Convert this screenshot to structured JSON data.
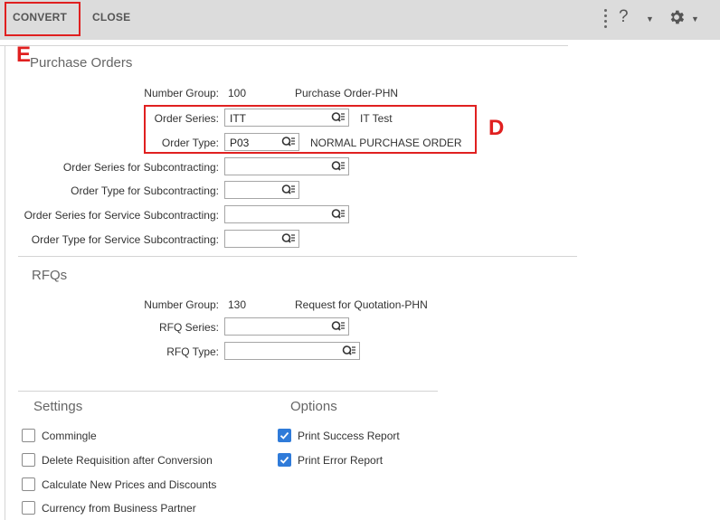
{
  "toolbar": {
    "convert_label": "CONVERT",
    "close_label": "CLOSE",
    "help_icon": "?",
    "caret": "▼"
  },
  "annotations": {
    "e": "E",
    "d": "D"
  },
  "purchase_orders": {
    "title": "Purchase Orders",
    "number_group_label": "Number Group:",
    "number_group_value": "100",
    "number_group_desc": "Purchase Order-PHN",
    "order_series_label": "Order Series:",
    "order_series_value": "ITT",
    "order_series_desc": "IT Test",
    "order_type_label": "Order Type:",
    "order_type_value": "P03",
    "order_type_desc": "NORMAL PURCHASE ORDER",
    "order_series_sub_label": "Order Series for Subcontracting:",
    "order_series_sub_value": "",
    "order_type_sub_label": "Order Type for Subcontracting:",
    "order_type_sub_value": "",
    "order_series_svc_label": "Order Series for Service Subcontracting:",
    "order_series_svc_value": "",
    "order_type_svc_label": "Order Type for Service Subcontracting:",
    "order_type_svc_value": ""
  },
  "rfqs": {
    "title": "RFQs",
    "number_group_label": "Number Group:",
    "number_group_value": "130",
    "number_group_desc": "Request for Quotation-PHN",
    "rfq_series_label": "RFQ Series:",
    "rfq_series_value": "",
    "rfq_type_label": "RFQ Type:",
    "rfq_type_value": ""
  },
  "settings": {
    "title": "Settings",
    "items": [
      {
        "label": "Commingle",
        "checked": false
      },
      {
        "label": "Delete Requisition after Conversion",
        "checked": false
      },
      {
        "label": "Calculate New Prices and Discounts",
        "checked": false
      },
      {
        "label": "Currency from Business Partner",
        "checked": false
      }
    ]
  },
  "options": {
    "title": "Options",
    "items": [
      {
        "label": "Print Success Report",
        "checked": true
      },
      {
        "label": "Print Error Report",
        "checked": true
      }
    ]
  },
  "colors": {
    "accent": "#2f7bd9",
    "annotation": "#e02020",
    "toolbar_bg": "#dcdcdc"
  },
  "icons": {
    "lookup": "value-help-icon",
    "gear": "gear-icon",
    "help": "help-icon",
    "more": "kebab-menu-icon"
  }
}
